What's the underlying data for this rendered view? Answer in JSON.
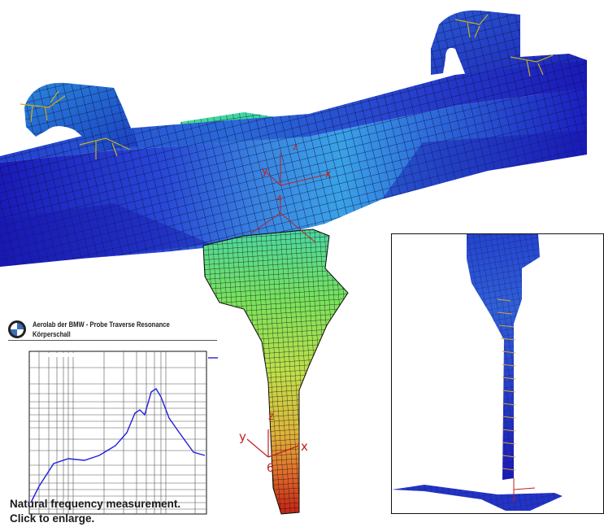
{
  "caption": {
    "line1": "Natural frequency measurement.",
    "line2": "Click to enlarge."
  },
  "inset": {
    "title": "Aerolab der BMW - Probe Traverse Resonance",
    "subtitle": "Körperschall",
    "logo": "bmw-logo-icon"
  },
  "axis_triads": [
    {
      "x": "x",
      "y": "y",
      "z": "z",
      "id": "4"
    },
    {
      "x": "x",
      "y": "y",
      "z": "z",
      "id": "6"
    }
  ],
  "colors": {
    "beam_dark": "#1a1ab8",
    "beam_mid": "#2a72d8",
    "beam_light": "#3a9ae6",
    "mesh": "#0d0d40",
    "green": "#5ae08a",
    "yellow": "#d6d84a",
    "red": "#cc2b1a",
    "axis_red": "#c02020"
  }
}
